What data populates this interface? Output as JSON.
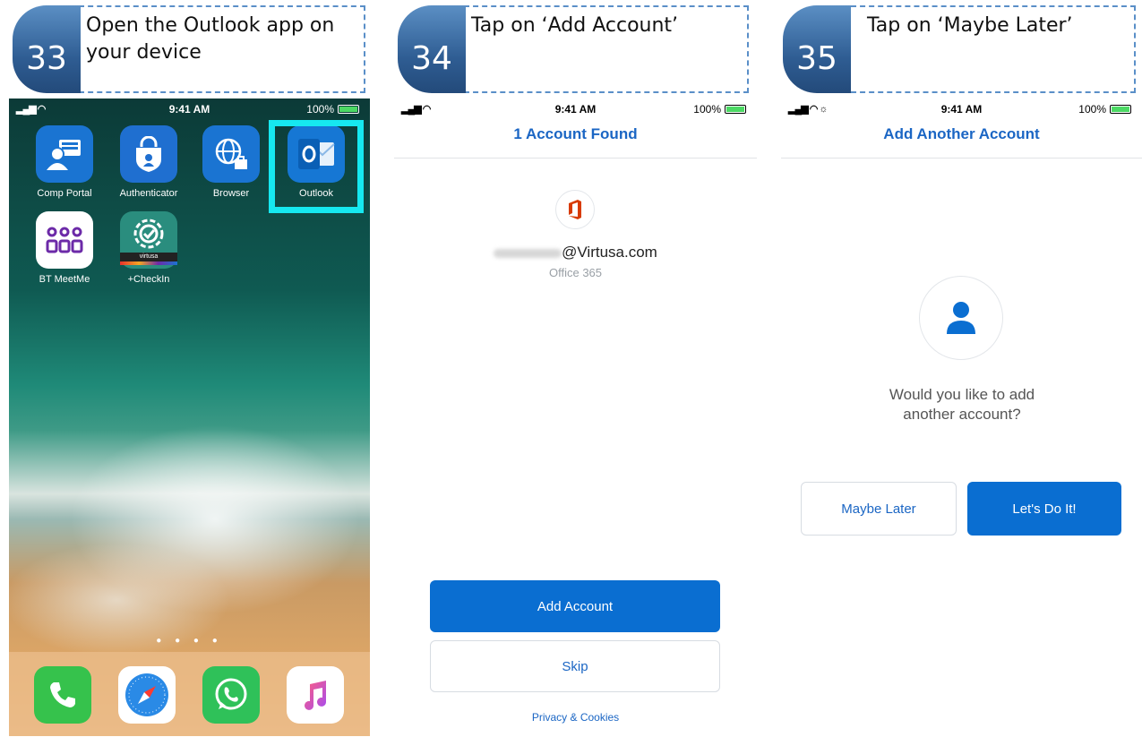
{
  "steps": [
    {
      "number": "33",
      "caption": "Open the Outlook app on your device"
    },
    {
      "number": "34",
      "caption": "Tap on ‘Add Account’"
    },
    {
      "number": "35",
      "caption": "Tap on ‘Maybe Later’"
    }
  ],
  "status_bar": {
    "time": "9:41 AM",
    "battery": "100%"
  },
  "home_screen": {
    "apps": [
      {
        "label": "Comp Portal",
        "icon": "company-portal-icon",
        "color": "#1a74d2"
      },
      {
        "label": "Authenticator",
        "icon": "authenticator-icon",
        "color": "#1f6fd0"
      },
      {
        "label": "Browser",
        "icon": "browser-icon",
        "color": "#1a74d2"
      },
      {
        "label": "Outlook",
        "icon": "outlook-icon",
        "color": "#1677d4"
      },
      {
        "label": "BT MeetMe",
        "icon": "bt-meetme-icon",
        "color": "#ffffff"
      },
      {
        "label": "+CheckIn",
        "icon": "checkin-icon",
        "color": "#2a8d7e",
        "sublabel": "virtusa"
      }
    ],
    "highlight_color": "#16e8f0",
    "dock": [
      "phone-icon",
      "safari-icon",
      "whatsapp-icon",
      "music-icon"
    ]
  },
  "account_found": {
    "title": "1 Account Found",
    "email_suffix": "@Virtusa.com",
    "account_type": "Office 365",
    "primary_button": "Add Account",
    "secondary_button": "Skip",
    "footer_link": "Privacy & Cookies"
  },
  "add_another": {
    "title": "Add Another Account",
    "question": "Would you like to add another account?",
    "secondary_button": "Maybe Later",
    "primary_button": "Let's Do It!"
  },
  "colors": {
    "brand_blue": "#0a6ed1",
    "title_blue": "#1b66c4",
    "step_blue": "#2f5d93"
  }
}
